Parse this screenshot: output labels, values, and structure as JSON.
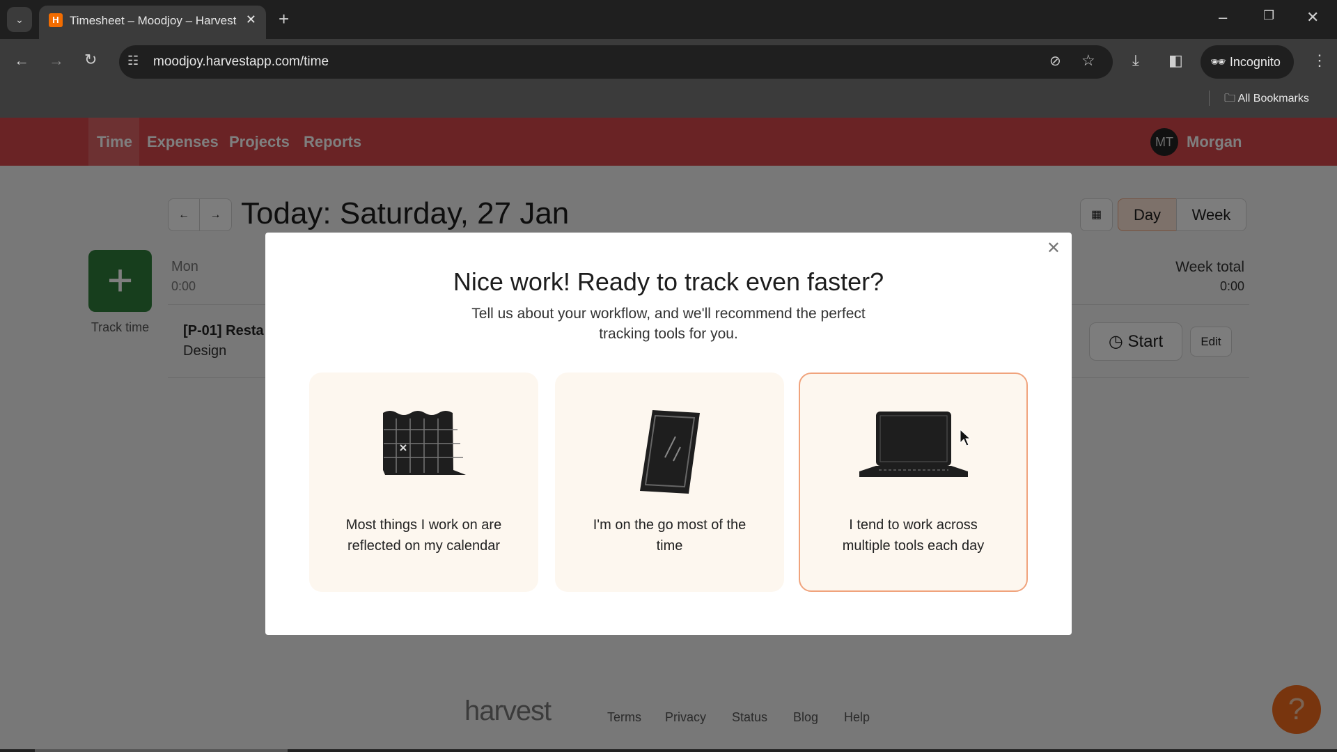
{
  "browser": {
    "tab_title": "Timesheet – Moodjoy – Harvest",
    "url": "moodjoy.harvestapp.com/time",
    "incognito_label": "Incognito",
    "bookmarks_label": "All Bookmarks"
  },
  "nav": {
    "items": [
      "Time",
      "Expenses",
      "Projects",
      "Reports"
    ],
    "active": "Time",
    "user_initials": "MT",
    "user_name": "Morgan"
  },
  "header": {
    "title": "Today: Saturday, 27 Jan",
    "day_label": "Day",
    "week_label": "Week",
    "view_selected": "Day"
  },
  "track_time_label": "Track time",
  "day": {
    "name": "Mon",
    "total": "0:00"
  },
  "week_total": {
    "label": "Week total",
    "value": "0:00"
  },
  "entry": {
    "project": "[P-01] Resta",
    "task": "Design",
    "start_label": "Start",
    "edit_label": "Edit"
  },
  "modal": {
    "title": "Nice work! Ready to track even faster?",
    "subtitle_line1": "Tell us about your workflow, and we'll recommend the perfect",
    "subtitle_line2": "tracking tools for you.",
    "options": [
      {
        "line1": "Most things I work on are",
        "line2": "reflected on my calendar",
        "icon": "calendar-icon"
      },
      {
        "line1": "I'm on the go most of the",
        "line2": "time",
        "icon": "phone-icon"
      },
      {
        "line1": "I tend to work across",
        "line2": "multiple tools each day",
        "icon": "laptop-icon",
        "selected": true
      }
    ]
  },
  "footer": {
    "logo": "harvest",
    "links": [
      "Terms",
      "Privacy",
      "Status",
      "Blog",
      "Help"
    ]
  },
  "colors": {
    "nav": "#d4474b",
    "track_button": "#2e7d3a",
    "help_button": "#f06a1c",
    "selected_border": "#f0a37c"
  }
}
